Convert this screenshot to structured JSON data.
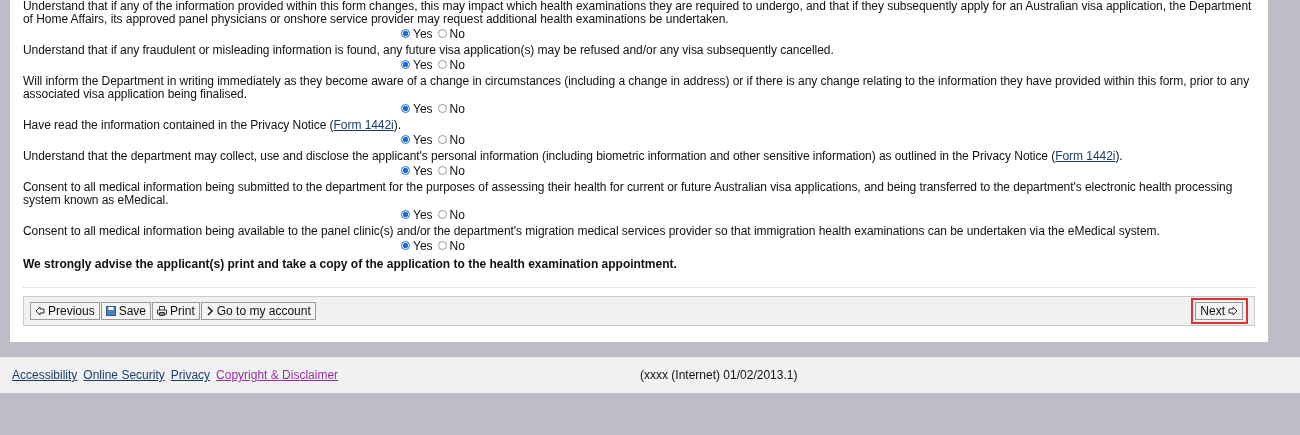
{
  "declarations": [
    {
      "before": "Understand that if any of the information provided within this form changes, this may impact which health examinations they are required to undergo, and that if they subsequently apply for an Australian visa application, the Department of Home Affairs, its approved panel physicians or onshore service provider may request additional health examinations be undertaken.",
      "options": [
        {
          "label": "Yes",
          "selected": true
        },
        {
          "label": "No",
          "selected": false
        }
      ]
    },
    {
      "before": "Understand that if any fraudulent or misleading information is found, any future visa application(s) may be refused and/or any visa subsequently cancelled.",
      "options": [
        {
          "label": "Yes",
          "selected": true
        },
        {
          "label": "No",
          "selected": false
        }
      ]
    },
    {
      "before": "Will inform the Department in writing immediately as they become aware of a change in circumstances (including a change in address) or if there is any change relating to the information they have provided within this form, prior to any associated visa application being finalised.",
      "options": [
        {
          "label": "Yes",
          "selected": true
        },
        {
          "label": "No",
          "selected": false
        }
      ]
    },
    {
      "before": "Have read the information contained in the Privacy Notice (",
      "link": "Form 1442i",
      "after": ").",
      "options": [
        {
          "label": "Yes",
          "selected": true
        },
        {
          "label": "No",
          "selected": false
        }
      ]
    },
    {
      "before": "Understand that the department may collect, use and disclose the applicant's personal information (including biometric information and other sensitive information) as outlined in the Privacy Notice (",
      "link": "Form 1442i",
      "after": ").",
      "options": [
        {
          "label": "Yes",
          "selected": true
        },
        {
          "label": "No",
          "selected": false
        }
      ]
    },
    {
      "before": "Consent to all medical information being submitted to the department for the purposes of assessing their health for current or future Australian visa applications, and being transferred to the department's electronic health processing system known as eMedical.",
      "options": [
        {
          "label": "Yes",
          "selected": true
        },
        {
          "label": "No",
          "selected": false
        }
      ]
    },
    {
      "before": "Consent to all medical information being available to the panel clinic(s) and/or the department's migration medical services provider so that immigration health examinations can be undertaken via the eMedical system.",
      "options": [
        {
          "label": "Yes",
          "selected": true
        },
        {
          "label": "No",
          "selected": false
        }
      ]
    }
  ],
  "advice": "We strongly advise the applicant(s) print and take a copy of the application to the health examination appointment.",
  "toolbar": {
    "buttons": [
      {
        "kind": "previous",
        "label": "Previous"
      },
      {
        "kind": "save",
        "label": "Save"
      },
      {
        "kind": "print",
        "label": "Print"
      },
      {
        "kind": "account",
        "label": "Go to my account"
      }
    ],
    "next": {
      "label": "Next",
      "highlighted": true
    }
  },
  "footer": {
    "links": [
      {
        "label": "Accessibility",
        "visited": false
      },
      {
        "label": "Online Security",
        "visited": false
      },
      {
        "label": "Privacy",
        "visited": false
      },
      {
        "label": "Copyright & Disclaimer",
        "visited": true
      }
    ],
    "version": "(xxxx (Internet) 01/02/2013.1)"
  }
}
